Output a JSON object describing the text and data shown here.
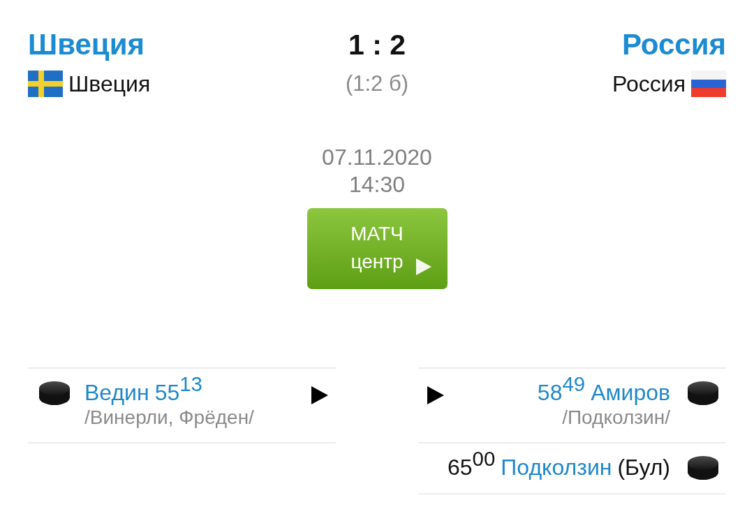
{
  "home_team": {
    "title": "Швеция",
    "name": "Швеция"
  },
  "score": "1 : 2",
  "score_detail": "(1:2 б)",
  "away_team": {
    "title": "Россия",
    "name": "Россия"
  },
  "date": "07.11.2020",
  "time": "14:30",
  "match_center_button": {
    "line_1": "МАТЧ",
    "line_2": "центр"
  },
  "goals": {
    "home": [
      {
        "kind": "goal",
        "scorer": "Ведин",
        "time": "55$^{13}$",
        "assists": "/Винерли, Фрёден/",
        "video": true
      }
    ],
    "away": [
      {
        "kind": "goal",
        "scorer": "Амиров",
        "time": "58$^{49}$",
        "assists": "/Подколзин/",
        "video": true
      },
      {
        "kind": "shootout",
        "scorer": "Подколзин",
        "time": "65$^{00}$",
        "note": "(Бул)",
        "video": false
      }
    ]
  }
}
